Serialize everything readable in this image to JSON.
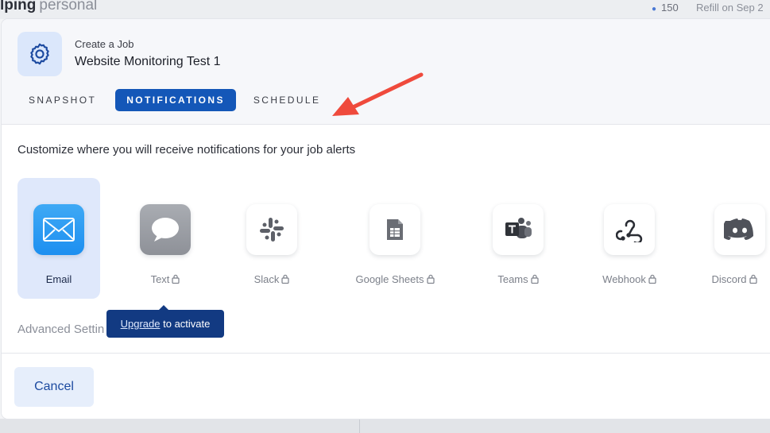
{
  "background": {
    "title_bold": "lping",
    "title_muted": "personal",
    "credits": "150",
    "refill": "Refill on Sep 2"
  },
  "modal": {
    "eyebrow": "Create a Job",
    "job_name": "Website Monitoring Test 1",
    "tabs": [
      {
        "label": "SNAPSHOT",
        "active": false
      },
      {
        "label": "NOTIFICATIONS",
        "active": true
      },
      {
        "label": "SCHEDULE",
        "active": false
      }
    ],
    "intro": "Customize where you will receive notifications for your job alerts",
    "channels": [
      {
        "label": "Email",
        "icon": "email-icon",
        "locked": false,
        "selected": true
      },
      {
        "label": "Text",
        "icon": "chat-bubble-icon",
        "locked": true,
        "selected": false
      },
      {
        "label": "Slack",
        "icon": "slack-icon",
        "locked": true,
        "selected": false
      },
      {
        "label": "Google Sheets",
        "icon": "google-sheets-icon",
        "locked": true,
        "selected": false
      },
      {
        "label": "Teams",
        "icon": "teams-icon",
        "locked": true,
        "selected": false
      },
      {
        "label": "Webhook",
        "icon": "webhook-icon",
        "locked": true,
        "selected": false
      },
      {
        "label": "Discord",
        "icon": "discord-icon",
        "locked": true,
        "selected": false
      }
    ],
    "tooltip": {
      "link": "Upgrade",
      "text": "to activate"
    },
    "advanced": "Advanced Settin",
    "cancel_label": "Cancel"
  },
  "colors": {
    "primary": "#1457b8",
    "tooltip": "#123a82",
    "selected_bg": "#dfe8fb",
    "arrow": "#ef4a3c"
  }
}
